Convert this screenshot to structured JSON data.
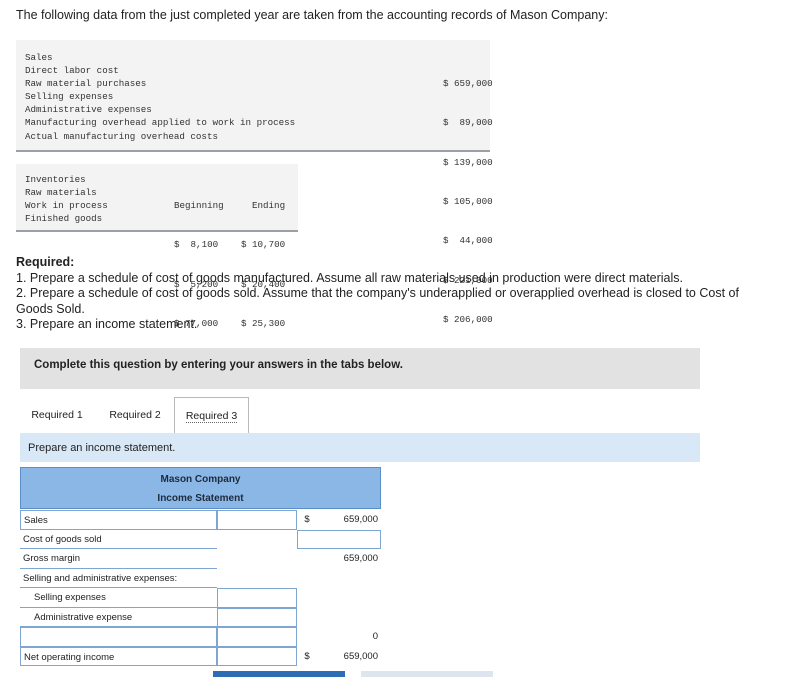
{
  "intro": "The following data from the just completed year are taken from the accounting records of Mason Company:",
  "data_table": {
    "rows": [
      {
        "label": "Sales",
        "value": "$ 659,000"
      },
      {
        "label": "Direct labor cost",
        "value": "$  89,000"
      },
      {
        "label": "Raw material purchases",
        "value": "$ 139,000"
      },
      {
        "label": "Selling expenses",
        "value": "$ 105,000"
      },
      {
        "label": "Administrative expenses",
        "value": "$  44,000"
      },
      {
        "label": "Manufacturing overhead applied to work in process",
        "value": "$ 221,000"
      },
      {
        "label": "Actual manufacturing overhead costs",
        "value": "$ 206,000"
      }
    ]
  },
  "inventories": {
    "header": {
      "label": "Inventories",
      "beginning": "Beginning",
      "ending": "Ending"
    },
    "rows": [
      {
        "label": "Raw materials",
        "beginning": "$  8,100",
        "ending": "$ 10,700"
      },
      {
        "label": "Work in process",
        "beginning": "$  5,200",
        "ending": "$ 20,400"
      },
      {
        "label": "Finished goods",
        "beginning": "$ 77,000",
        "ending": "$ 25,300"
      }
    ]
  },
  "required": {
    "heading": "Required:",
    "items": [
      "1. Prepare a schedule of cost of goods manufactured. Assume all raw materials used in production were direct materials.",
      "2. Prepare a schedule of cost of goods sold. Assume that the company's underapplied or overapplied overhead is closed to Cost of Goods Sold.",
      "3. Prepare an income statement."
    ]
  },
  "banner": "Complete this question by entering your answers in the tabs below.",
  "tabs": [
    {
      "label": "Required 1",
      "active": false
    },
    {
      "label": "Required 2",
      "active": false
    },
    {
      "label": "Required 3",
      "active": true
    }
  ],
  "prompt": "Prepare an income statement.",
  "statement": {
    "company": "Mason Company",
    "title": "Income Statement",
    "rows": {
      "sales": {
        "label": "Sales",
        "dollar": "$",
        "amount": "659,000"
      },
      "cogs": {
        "label": "Cost of goods sold",
        "amount": ""
      },
      "gross": {
        "label": "Gross margin",
        "amount": "659,000"
      },
      "sga": {
        "label": "Selling and administrative expenses:"
      },
      "selling": {
        "label": "Selling expenses",
        "value": ""
      },
      "admin": {
        "label": "Administrative expense",
        "value": ""
      },
      "blank": {
        "label": "",
        "value": "",
        "amount": "0"
      },
      "net": {
        "label": "Net operating income",
        "dollar": "$",
        "amount": "659,000"
      }
    }
  }
}
